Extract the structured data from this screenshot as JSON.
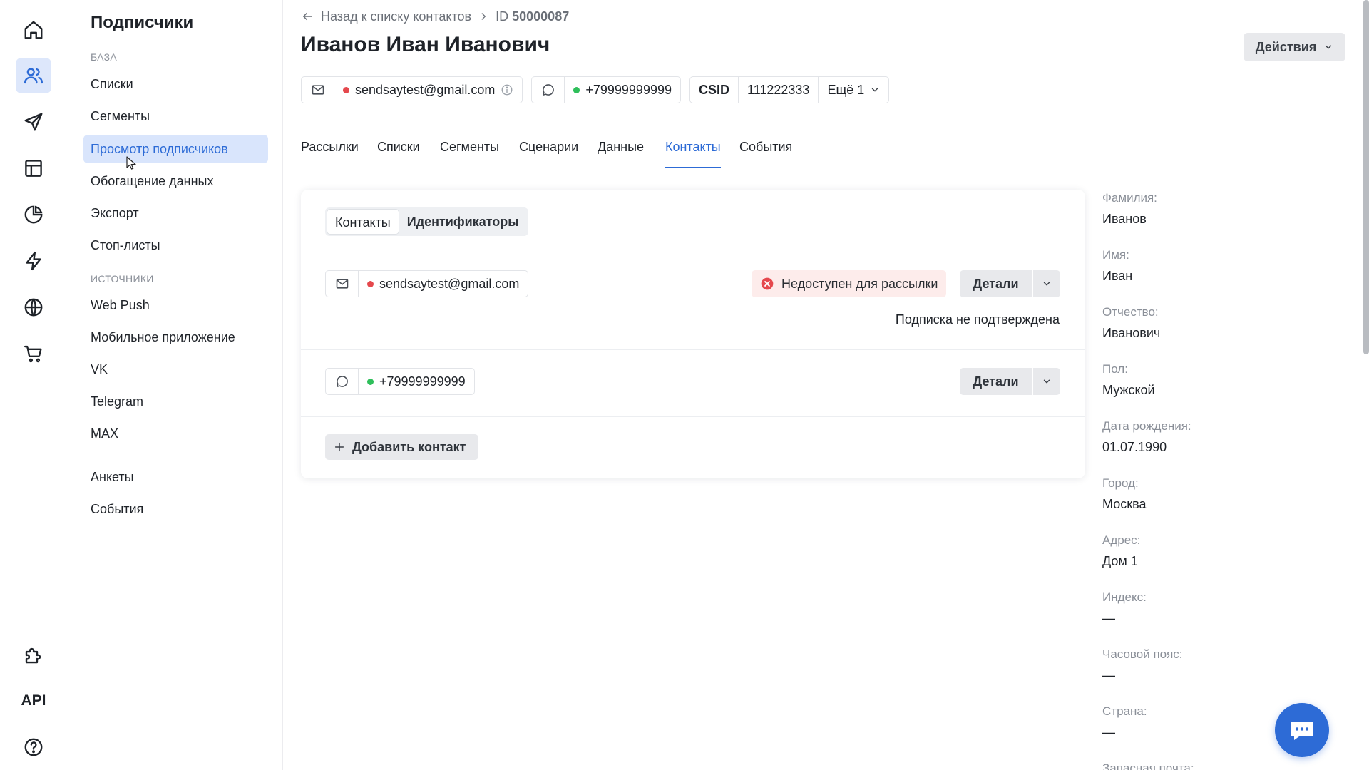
{
  "rail": {
    "items": [
      {
        "name": "home-icon"
      },
      {
        "name": "users-icon",
        "active": true
      },
      {
        "name": "send-icon"
      },
      {
        "name": "layout-icon"
      },
      {
        "name": "pie-chart-icon"
      },
      {
        "name": "lightning-icon"
      },
      {
        "name": "globe-icon"
      },
      {
        "name": "cart-icon"
      },
      {
        "name": "puzzle-icon"
      }
    ],
    "api_label": "API",
    "help": "help-icon"
  },
  "nav": {
    "title": "Подписчики",
    "section_base": "БАЗА",
    "base_items": [
      "Списки",
      "Сегменты",
      "Просмотр подписчиков",
      "Обогащение данных",
      "Экспорт",
      "Стоп-листы"
    ],
    "section_sources": "ИСТОЧНИКИ",
    "source_items": [
      "Web Push",
      "Мобильное приложение",
      "VK",
      "Telegram",
      "MAX"
    ],
    "extra_items": [
      "Анкеты",
      "События"
    ],
    "active_item": "Просмотр подписчиков"
  },
  "header": {
    "back_label": "Назад к списку контактов",
    "id_prefix": "ID",
    "id_value": "50000087",
    "title": "Иванов Иван Иванович",
    "actions_label": "Действия"
  },
  "chips": {
    "email": "sendsaytest@gmail.com",
    "phone": "+79999999999",
    "csid_label": "CSID",
    "csid_value": "111222333",
    "more_label": "Ещё 1"
  },
  "tabs": [
    "Рассылки",
    "Списки",
    "Сегменты",
    "Сценарии",
    "Данные",
    "Контакты",
    "События"
  ],
  "active_tab": "Контакты",
  "card": {
    "subtabs": [
      "Контакты",
      "Идентификаторы"
    ],
    "email_contact": "sendsaytest@gmail.com",
    "email_status": "Недоступен для рассылки",
    "details_label": "Детали",
    "subscription_note": "Подписка не подтверждена",
    "phone_contact": "+79999999999",
    "add_contact_label": "Добавить контакт"
  },
  "profile": [
    {
      "label": "Фамилия:",
      "value": "Иванов"
    },
    {
      "label": "Имя:",
      "value": "Иван"
    },
    {
      "label": "Отчество:",
      "value": "Иванович"
    },
    {
      "label": "Пол:",
      "value": "Мужской"
    },
    {
      "label": "Дата рождения:",
      "value": "01.07.1990"
    },
    {
      "label": "Город:",
      "value": "Москва"
    },
    {
      "label": "Адрес:",
      "value": "Дом 1"
    },
    {
      "label": "Индекс:",
      "value": "—"
    },
    {
      "label": "Часовой пояс:",
      "value": "—"
    },
    {
      "label": "Страна:",
      "value": "—"
    },
    {
      "label": "Запасная почта:",
      "value": ""
    }
  ],
  "colors": {
    "accent": "#2d6bd6",
    "status_error": "#e5484d",
    "status_ok": "#2fbf5b",
    "badge_bg": "#fdeceb"
  }
}
